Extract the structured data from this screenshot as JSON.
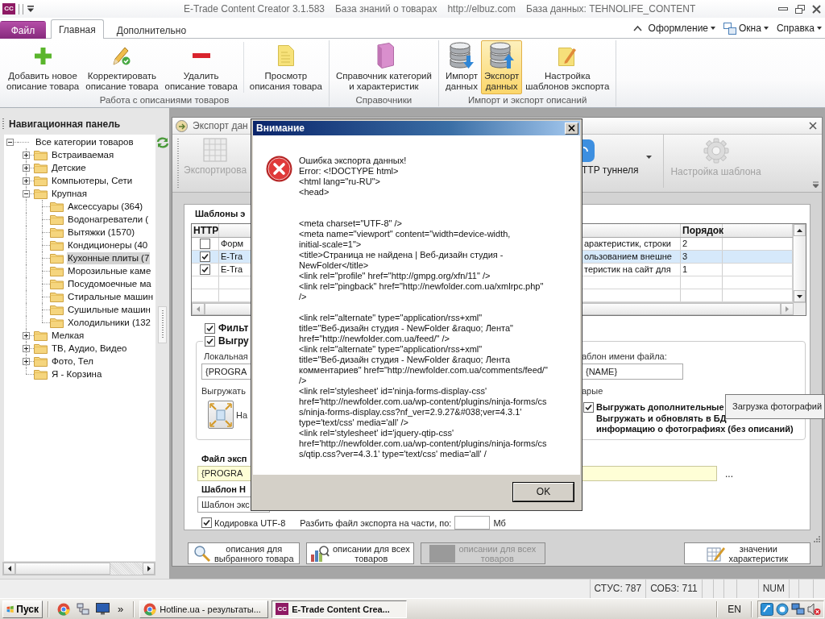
{
  "window": {
    "app_icon": "CC",
    "title_parts": [
      "E-Trade Content Creator 3.1.583",
      "База знаний о товарах",
      "http://elbuz.com",
      "База данных: TEHNOLIFE_CONTENT"
    ]
  },
  "ribbon": {
    "tabs": [
      {
        "label": "Файл",
        "kind": "file",
        "selected": false
      },
      {
        "label": "Главная",
        "kind": "page",
        "selected": true
      },
      {
        "label": "Дополнительно",
        "kind": "page",
        "selected": false
      }
    ],
    "menus": [
      "Оформление",
      "Окна",
      "Справка"
    ],
    "groups": [
      {
        "label": "Работа с описаниями товаров",
        "sections": [
          [
            {
              "label": "Добавить новое\nописание товара",
              "selected": false
            },
            {
              "label": "Корректировать\nописание товара",
              "selected": false
            },
            {
              "label": "Удалить\nописание товара",
              "selected": false
            }
          ],
          [
            {
              "label": "Просмотр\nописания товара",
              "selected": false
            }
          ]
        ]
      },
      {
        "label": "Справочники",
        "sections": [
          [
            {
              "label": "Справочник категорий\nи характеристик",
              "selected": false
            }
          ]
        ]
      },
      {
        "label": "Импорт и экспорт описаний",
        "sections": [
          [
            {
              "label": "Импорт\nданных",
              "selected": false
            },
            {
              "label": "Экспорт\nданных",
              "selected": true
            },
            {
              "label": "Настройка\nшаблонов экспорта",
              "selected": false
            }
          ]
        ]
      }
    ]
  },
  "nav_panel": {
    "title": "Навигационная панель",
    "tree": [
      {
        "label": "Все категории товаров",
        "expanded": true,
        "selected": false,
        "children": [
          {
            "label": "Встраиваемая",
            "expanded": false,
            "selected": false
          },
          {
            "label": "Детские",
            "expanded": false,
            "selected": false
          },
          {
            "label": "Компьютеры, Сети",
            "expanded": false,
            "selected": false
          },
          {
            "label": "Крупная",
            "expanded": true,
            "selected": false,
            "children": [
              {
                "label": "Аксессуары (364)",
                "selected": false
              },
              {
                "label": "Водонагреватели (",
                "selected": false
              },
              {
                "label": "Вытяжки (1570)",
                "selected": false
              },
              {
                "label": "Кондиционеры (40",
                "selected": false
              },
              {
                "label": "Кухонные плиты (7",
                "selected": true
              },
              {
                "label": "Морозильные каме",
                "selected": false
              },
              {
                "label": "Посудомоечные ма",
                "selected": false
              },
              {
                "label": "Стиральные машин",
                "selected": false
              },
              {
                "label": "Сушильные машин",
                "selected": false
              },
              {
                "label": "Холодильники (132",
                "selected": false
              }
            ]
          },
          {
            "label": "Мелкая",
            "expanded": false,
            "selected": false
          },
          {
            "label": "ТВ, Аудио, Видео",
            "expanded": false,
            "selected": false
          },
          {
            "label": "Фото, Тел",
            "expanded": false,
            "selected": false
          },
          {
            "label": "Я - Корзина",
            "selected": false
          }
        ]
      }
    ]
  },
  "export_window": {
    "title": "Экспорт дан",
    "toolbar": [
      {
        "label": "Экспортирова",
        "disabled": true,
        "dropdown": false
      },
      {
        "label": "TTP туннеля",
        "disabled": false,
        "dropdown": true
      },
      {
        "label": "Настройка шаблона",
        "disabled": true,
        "dropdown": false
      }
    ],
    "templates": {
      "title": "Шаблоны э",
      "columns": {
        "http": "HTTP",
        "order": "Порядок"
      },
      "rows": [
        {
          "name": "Форм",
          "description": "арактеристик, строки",
          "order": "2",
          "checked": false,
          "selected": false
        },
        {
          "name": "E-Tra",
          "description": "ользованием внешне",
          "order": "3",
          "checked": true,
          "selected": true
        },
        {
          "name": "E-Tra",
          "description": "теристик на сайт для",
          "order": "1",
          "checked": true,
          "selected": false
        }
      ]
    },
    "filter": {
      "label": "Фильт",
      "checked": true
    },
    "upload": {
      "label": "Выгру",
      "checked": true,
      "local_folder": {
        "label": "Локальная",
        "value": "{PROGRA"
      },
      "file_name_template": {
        "label": "аблон имени файла:",
        "value": "{NAME}"
      },
      "mode_label": "Выгружать",
      "mode_tail": "арые",
      "settings_caption": "На",
      "options": [
        {
          "label": "Выгружать дополнительные",
          "checked": true
        },
        {
          "label": "Выгружать и обновлять в БД\nинформацию о фотографиях (без описаний)"
        }
      ]
    },
    "export_file": {
      "label": "Файл эксп",
      "value": "{PROGRA",
      "browse": "..."
    },
    "name_template": {
      "label": "Шаблон Н",
      "value": "Шаблон экс"
    },
    "encoding": {
      "label": "Кодировка UTF-8",
      "checked": true
    },
    "split": {
      "label": "Разбить файл экспорта на части, по:",
      "unit": "Мб"
    },
    "bottom_buttons": [
      {
        "label": "описания для\nвыбранного товара",
        "disabled": false
      },
      {
        "label": "описании для всех\nтоваров",
        "disabled": false
      },
      {
        "label": "описании для всех\nтоваров",
        "disabled": true
      },
      {
        "label": "значении\nхарактеристик",
        "disabled": false
      }
    ]
  },
  "dialog": {
    "title": "Внимание",
    "message": "Ошибка экспорта данных!\nError: <!DOCTYPE html>\n<html lang=\"ru-RU\">\n<head>\n\n\n<meta charset=\"UTF-8\" />\n<meta name=\"viewport\" content=\"width=device-width,\ninitial-scale=1\">\n<title>Страница не найдена | Веб-дизайн студия -\nNewFolder</title>\n<link rel=\"profile\" href=\"http://gmpg.org/xfn/11\" />\n<link rel=\"pingback\" href=\"http://newfolder.com.ua/xmlrpc.php\"\n/>\n\n<link rel=\"alternate\" type=\"application/rss+xml\"\ntitle=\"Веб-дизайн студия - NewFolder &raquo; Лента\"\nhref=\"http://newfolder.com.ua/feed/\" />\n<link rel=\"alternate\" type=\"application/rss+xml\"\ntitle=\"Веб-дизайн студия - NewFolder &raquo; Лента\nкомментариев\" href=\"http://newfolder.com.ua/comments/feed/\"\n/>\n<link rel='stylesheet' id='ninja-forms-display-css'\nhref='http://newfolder.com.ua/wp-content/plugins/ninja-forms/cs\ns/ninja-forms-display.css?nf_ver=2.9.27&#038;ver=4.3.1'\ntype='text/css' media='all' />\n<link rel='stylesheet' id='jquery-qtip-css'\nhref='http://newfolder.com.ua/wp-content/plugins/ninja-forms/cs\ns/qtip.css?ver=4.3.1' type='text/css' media='all' /",
    "button": "OK"
  },
  "tooltip": {
    "text": "Загрузка фотографий"
  },
  "status_bar": {
    "cells": [
      "СТУС: 787",
      "СОБЗ: 711",
      "NUM"
    ]
  },
  "taskbar": {
    "start": "Пуск",
    "more": "»",
    "tasks": [
      {
        "label": "Hotline.ua - результаты...",
        "selected": false
      },
      {
        "label": "E-Trade Content Crea...",
        "icon_text": "CC",
        "selected": true
      }
    ],
    "language": "EN"
  }
}
